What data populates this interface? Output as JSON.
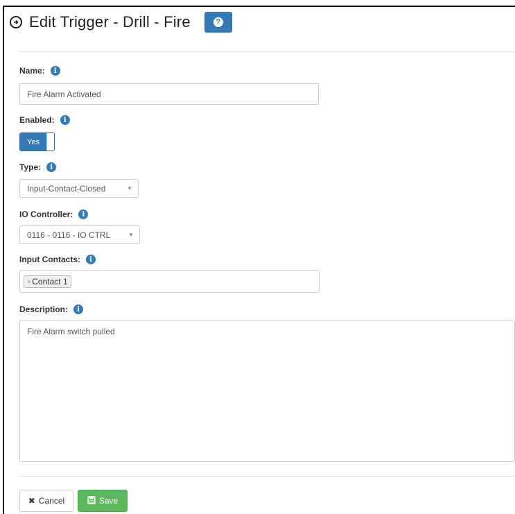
{
  "header": {
    "title": "Edit Trigger - Drill - Fire",
    "help_glyph": "?"
  },
  "form": {
    "name": {
      "label": "Name:",
      "value": "Fire Alarm Activated"
    },
    "enabled": {
      "label": "Enabled:",
      "value": "Yes"
    },
    "type": {
      "label": "Type:",
      "value": "Input-Contact-Closed"
    },
    "io_controller": {
      "label": "IO Controller:",
      "value": "0116 - 0116 - IO CTRL"
    },
    "input_contacts": {
      "label": "Input Contacts:",
      "tags": [
        "Contact 1"
      ]
    },
    "description": {
      "label": "Description:",
      "value": "Fire Alarm switch pulled"
    }
  },
  "actions": {
    "cancel_label": "Cancel",
    "save_label": "Save"
  },
  "icons": {
    "info": "info-circle-icon",
    "help": "question-circle-icon",
    "header": "arrow-circle-icon",
    "cancel": "x-icon",
    "save": "floppy-disk-icon"
  },
  "colors": {
    "primary": "#337ab7",
    "success": "#5cb85c",
    "border": "#cccccc"
  }
}
